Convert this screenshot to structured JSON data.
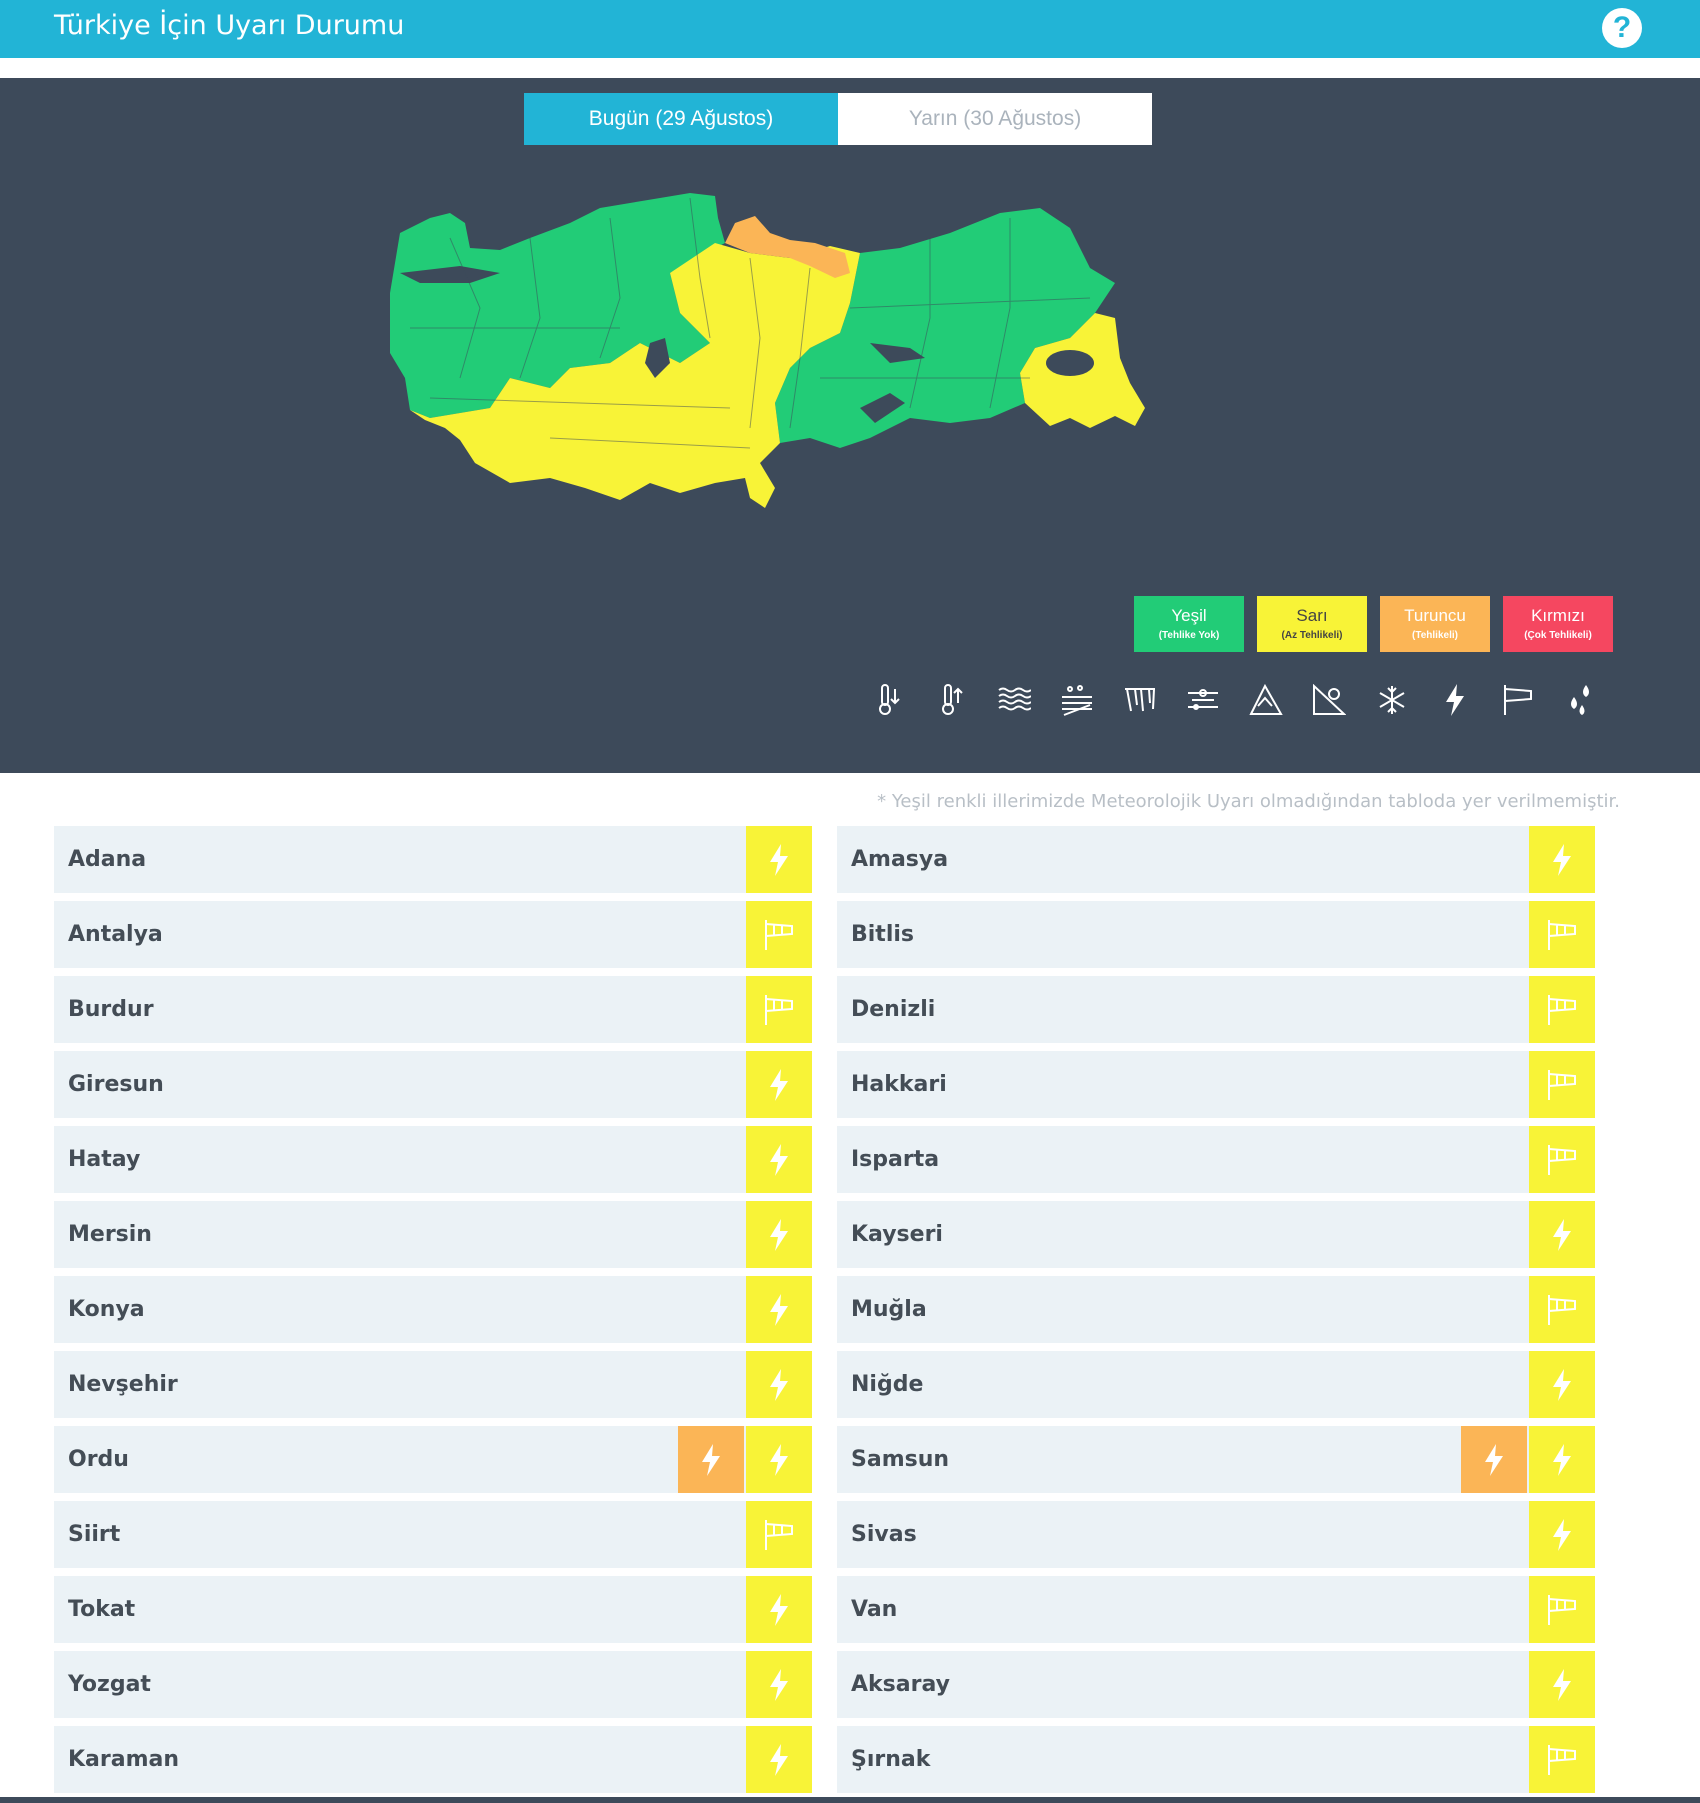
{
  "header": {
    "title": "Türkiye İçin Uyarı Durumu",
    "help_icon": "?"
  },
  "tabs": [
    {
      "label": "Bugün (29 Ağustos)",
      "active": true
    },
    {
      "label": "Yarın (30 Ağustos)",
      "active": false
    }
  ],
  "colors": {
    "green": "#22cc77",
    "yellow": "#f8f337",
    "orange": "#fbb556",
    "red": "#f54760",
    "panel": "#3d4a5a",
    "accent": "#22b4d6"
  },
  "legend": [
    {
      "label": "Yeşil",
      "sub": "(Tehlike Yok)"
    },
    {
      "label": "Sarı",
      "sub": "(Az Tehlikeli)"
    },
    {
      "label": "Turuncu",
      "sub": "(Tehlikeli)"
    },
    {
      "label": "Kırmızı",
      "sub": "(Çok Tehlikeli)"
    }
  ],
  "warning_types": [
    "cold-icon",
    "heat-icon",
    "fog-icon",
    "dust-icon",
    "ice-icon",
    "snowmelt-icon",
    "avalanche-icon",
    "landslide-icon",
    "snow-icon",
    "thunderstorm-icon",
    "wind-icon",
    "rain-icon"
  ],
  "note": "* Yeşil renkli illerimizde Meteorolojik Uyarı olmadığından tabloda yer verilmemiştir.",
  "provinces_left": [
    {
      "name": "Adana",
      "warnings": [
        {
          "level": "yellow",
          "type": "thunderstorm"
        }
      ]
    },
    {
      "name": "Antalya",
      "warnings": [
        {
          "level": "yellow",
          "type": "wind"
        }
      ]
    },
    {
      "name": "Burdur",
      "warnings": [
        {
          "level": "yellow",
          "type": "wind"
        }
      ]
    },
    {
      "name": "Giresun",
      "warnings": [
        {
          "level": "yellow",
          "type": "thunderstorm"
        }
      ]
    },
    {
      "name": "Hatay",
      "warnings": [
        {
          "level": "yellow",
          "type": "thunderstorm"
        }
      ]
    },
    {
      "name": "Mersin",
      "warnings": [
        {
          "level": "yellow",
          "type": "thunderstorm"
        }
      ]
    },
    {
      "name": "Konya",
      "warnings": [
        {
          "level": "yellow",
          "type": "thunderstorm"
        }
      ]
    },
    {
      "name": "Nevşehir",
      "warnings": [
        {
          "level": "yellow",
          "type": "thunderstorm"
        }
      ]
    },
    {
      "name": "Ordu",
      "warnings": [
        {
          "level": "yellow",
          "type": "thunderstorm"
        },
        {
          "level": "orange",
          "type": "thunderstorm"
        }
      ]
    },
    {
      "name": "Siirt",
      "warnings": [
        {
          "level": "yellow",
          "type": "wind"
        }
      ]
    },
    {
      "name": "Tokat",
      "warnings": [
        {
          "level": "yellow",
          "type": "thunderstorm"
        }
      ]
    },
    {
      "name": "Yozgat",
      "warnings": [
        {
          "level": "yellow",
          "type": "thunderstorm"
        }
      ]
    },
    {
      "name": "Karaman",
      "warnings": [
        {
          "level": "yellow",
          "type": "thunderstorm"
        }
      ]
    }
  ],
  "provinces_right": [
    {
      "name": "Amasya",
      "warnings": [
        {
          "level": "yellow",
          "type": "thunderstorm"
        }
      ]
    },
    {
      "name": "Bitlis",
      "warnings": [
        {
          "level": "yellow",
          "type": "wind"
        }
      ]
    },
    {
      "name": "Denizli",
      "warnings": [
        {
          "level": "yellow",
          "type": "wind"
        }
      ]
    },
    {
      "name": "Hakkari",
      "warnings": [
        {
          "level": "yellow",
          "type": "wind"
        }
      ]
    },
    {
      "name": "Isparta",
      "warnings": [
        {
          "level": "yellow",
          "type": "wind"
        }
      ]
    },
    {
      "name": "Kayseri",
      "warnings": [
        {
          "level": "yellow",
          "type": "thunderstorm"
        }
      ]
    },
    {
      "name": "Muğla",
      "warnings": [
        {
          "level": "yellow",
          "type": "wind"
        }
      ]
    },
    {
      "name": "Niğde",
      "warnings": [
        {
          "level": "yellow",
          "type": "thunderstorm"
        }
      ]
    },
    {
      "name": "Samsun",
      "warnings": [
        {
          "level": "yellow",
          "type": "thunderstorm"
        },
        {
          "level": "orange",
          "type": "thunderstorm"
        }
      ]
    },
    {
      "name": "Sivas",
      "warnings": [
        {
          "level": "yellow",
          "type": "thunderstorm"
        }
      ]
    },
    {
      "name": "Van",
      "warnings": [
        {
          "level": "yellow",
          "type": "wind"
        }
      ]
    },
    {
      "name": "Aksaray",
      "warnings": [
        {
          "level": "yellow",
          "type": "thunderstorm"
        }
      ]
    },
    {
      "name": "Şırnak",
      "warnings": [
        {
          "level": "yellow",
          "type": "wind"
        }
      ]
    }
  ]
}
